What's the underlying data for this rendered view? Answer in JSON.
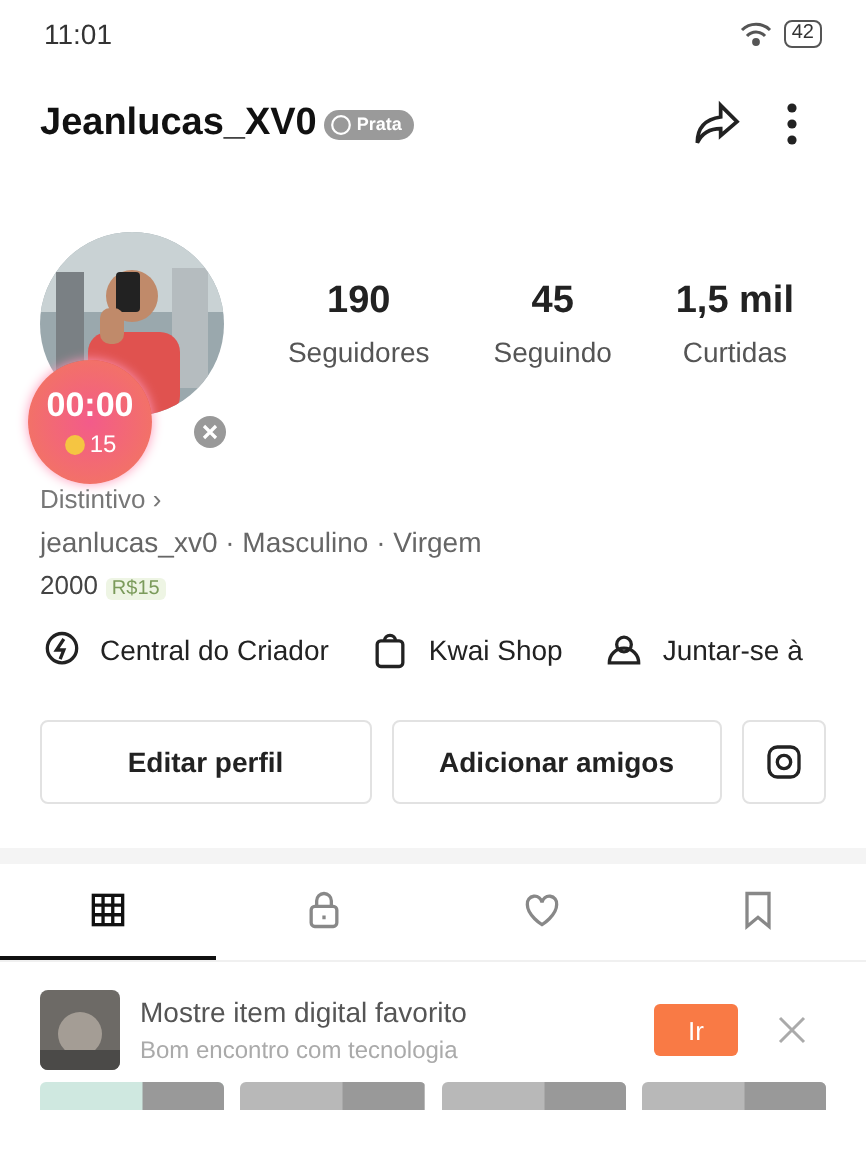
{
  "status_bar": {
    "time": "11:01",
    "battery": "42"
  },
  "header": {
    "username": "Jeanlucas_XV0",
    "badge": "Prata"
  },
  "stats": [
    {
      "value": "190",
      "label": "Seguidores"
    },
    {
      "value": "45",
      "label": "Seguindo"
    },
    {
      "value": "1,5 mil",
      "label": "Curtidas"
    }
  ],
  "profile": {
    "distinction": "Distintivo ›",
    "details": "jeanlucas_xv0 · Masculino · Virgem",
    "year": "2000"
  },
  "timer": {
    "time": "00:00",
    "coins": "15",
    "reward": "R$15"
  },
  "shortcuts": [
    {
      "kind": "bolt",
      "label": "Central do Criador"
    },
    {
      "kind": "bag",
      "label": "Kwai Shop"
    },
    {
      "kind": "group",
      "label": "Juntar-se à"
    }
  ],
  "buttons": [
    "Editar perfil",
    "Adicionar amigos"
  ],
  "tabs": [
    {
      "kind": "grid",
      "selected": true
    },
    {
      "kind": "lock",
      "selected": false
    },
    {
      "kind": "heart",
      "selected": false
    },
    {
      "kind": "bookmark",
      "selected": false
    }
  ],
  "banner": {
    "title": "Mostre item digital favorito",
    "subtitle": "Bom encontro com tecnologia",
    "action": "Ir"
  }
}
